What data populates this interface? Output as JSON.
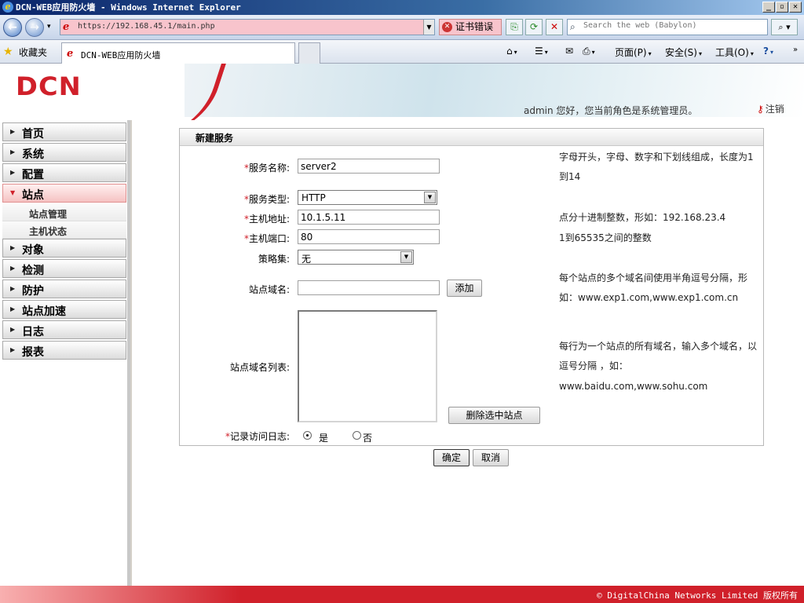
{
  "window": {
    "title": "DCN-WEB应用防火墙 - Windows Internet Explorer"
  },
  "browser": {
    "url": "https://192.168.45.1/main.php",
    "cert_error": "证书错误",
    "search_placeholder": "Search the web (Babylon)",
    "favorites_label": "收藏夹",
    "tab_title": "DCN-WEB应用防火墙",
    "commands": {
      "page": "页面(P)",
      "safety": "安全(S)",
      "tools": "工具(O)"
    }
  },
  "header": {
    "logo": "DCN",
    "user_message": "admin 您好，您当前角色是系统管理员。",
    "logout": "注销"
  },
  "sidebar": {
    "items": [
      {
        "label": "首页"
      },
      {
        "label": "系统"
      },
      {
        "label": "配置"
      },
      {
        "label": "站点",
        "expanded": true,
        "children": [
          {
            "label": "站点管理"
          },
          {
            "label": "主机状态"
          }
        ]
      },
      {
        "label": "对象"
      },
      {
        "label": "检测"
      },
      {
        "label": "防护"
      },
      {
        "label": "站点加速"
      },
      {
        "label": "日志"
      },
      {
        "label": "报表"
      }
    ]
  },
  "form": {
    "title": "新建服务",
    "service_name": {
      "label": "服务名称:",
      "value": "server2",
      "help": "字母开头，字母、数字和下划线组成，长度为1到14"
    },
    "service_type": {
      "label": "服务类型:",
      "value": "HTTP"
    },
    "host_address": {
      "label": "主机地址:",
      "value": "10.1.5.11",
      "help": "点分十进制整数，形如：192.168.23.4"
    },
    "host_port": {
      "label": "主机端口:",
      "value": "80",
      "help": "1到65535之间的整数"
    },
    "policy_set": {
      "label": "策略集:",
      "value": "无"
    },
    "site_domain": {
      "label": "站点域名:",
      "value": "",
      "add_button": "添加",
      "help": "每个站点的多个域名间使用半角逗号分隔，形如：www.exp1.com,www.exp1.com.cn"
    },
    "domain_list": {
      "label": "站点域名列表:",
      "items": [],
      "delete_button": "删除选中站点",
      "help_line1": "每行为一个站点的所有域名，输入多个域名，以逗号分隔 ，如：",
      "help_line2": "www.baidu.com,www.sohu.com"
    },
    "access_log": {
      "label": "记录访问日志:",
      "yes": "是",
      "no": "否",
      "selected": "yes"
    },
    "required_mark": "*"
  },
  "actions": {
    "ok": "确定",
    "cancel": "取消"
  },
  "footer": {
    "copyright": "© DigitalChina Networks Limited 版权所有"
  }
}
